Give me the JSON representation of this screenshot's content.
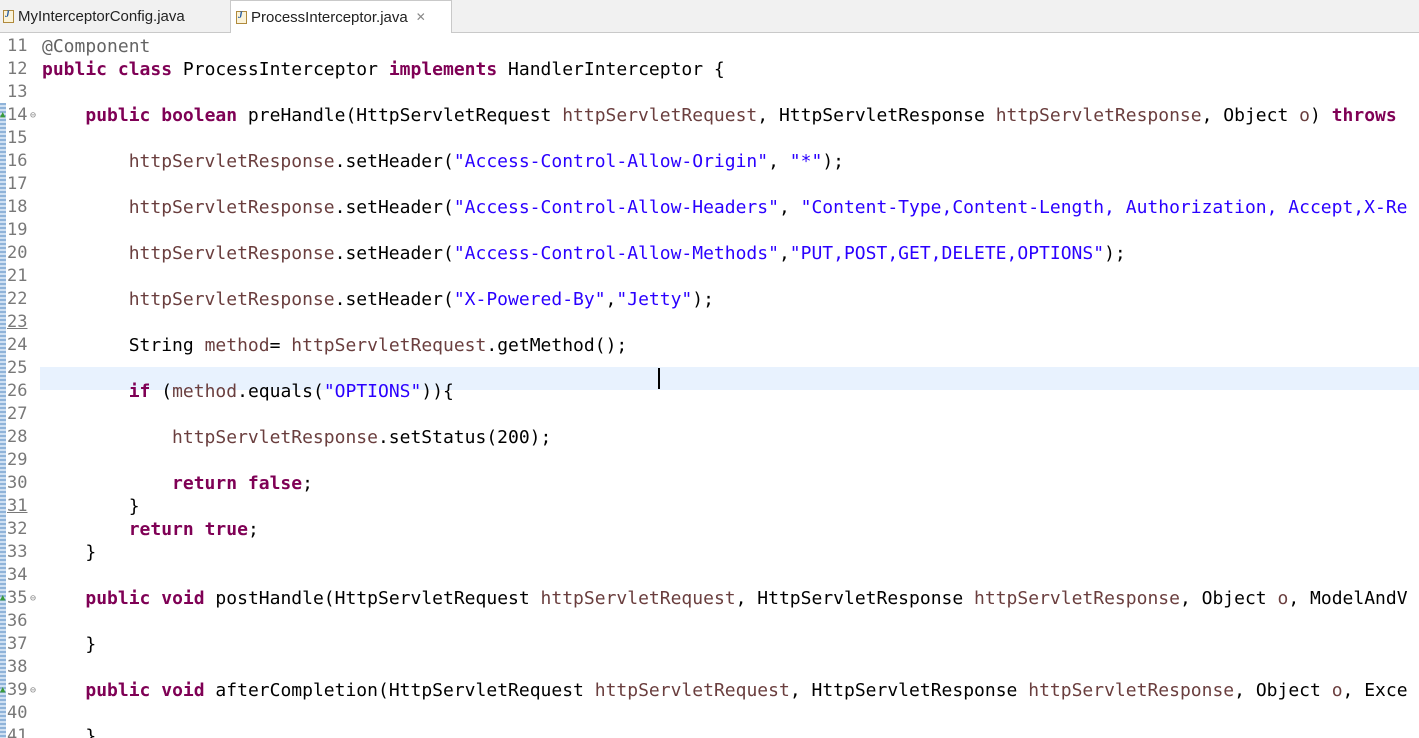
{
  "tabs": [
    {
      "label": "MyInterceptorConfig.java",
      "active": false,
      "icon": "java-file-icon"
    },
    {
      "label": "ProcessInterceptor.java",
      "active": true,
      "icon": "java-file-icon"
    }
  ],
  "tab_close_glyph": "✕",
  "editor": {
    "current_line": 24,
    "lines": [
      {
        "n": "11",
        "code": "@Component"
      },
      {
        "n": "12",
        "code": "public class ProcessInterceptor implements HandlerInterceptor {"
      },
      {
        "n": "13",
        "code": ""
      },
      {
        "n": "14",
        "code": "    public boolean preHandle(HttpServletRequest httpServletRequest, HttpServletResponse httpServletResponse, Object o) throws"
      },
      {
        "n": "15",
        "code": ""
      },
      {
        "n": "16",
        "code": "        httpServletResponse.setHeader(\"Access-Control-Allow-Origin\", \"*\");"
      },
      {
        "n": "17",
        "code": ""
      },
      {
        "n": "18",
        "code": "        httpServletResponse.setHeader(\"Access-Control-Allow-Headers\", \"Content-Type,Content-Length, Authorization, Accept,X-Re"
      },
      {
        "n": "19",
        "code": ""
      },
      {
        "n": "20",
        "code": "        httpServletResponse.setHeader(\"Access-Control-Allow-Methods\",\"PUT,POST,GET,DELETE,OPTIONS\");"
      },
      {
        "n": "21",
        "code": ""
      },
      {
        "n": "22",
        "code": "        httpServletResponse.setHeader(\"X-Powered-By\",\"Jetty\");"
      },
      {
        "n": "23",
        "code": ""
      },
      {
        "n": "24",
        "code": "        String method= httpServletRequest.getMethod();"
      },
      {
        "n": "25",
        "code": ""
      },
      {
        "n": "26",
        "code": "        if (method.equals(\"OPTIONS\")){"
      },
      {
        "n": "27",
        "code": ""
      },
      {
        "n": "28",
        "code": "            httpServletResponse.setStatus(200);"
      },
      {
        "n": "29",
        "code": ""
      },
      {
        "n": "30",
        "code": "            return false;"
      },
      {
        "n": "31",
        "code": "        }"
      },
      {
        "n": "32",
        "code": "        return true;"
      },
      {
        "n": "33",
        "code": "    }"
      },
      {
        "n": "34",
        "code": ""
      },
      {
        "n": "35",
        "code": "    public void postHandle(HttpServletRequest httpServletRequest, HttpServletResponse httpServletResponse, Object o, ModelAndV"
      },
      {
        "n": "36",
        "code": ""
      },
      {
        "n": "37",
        "code": "    }"
      },
      {
        "n": "38",
        "code": ""
      },
      {
        "n": "39",
        "code": "    public void afterCompletion(HttpServletRequest httpServletRequest, HttpServletResponse httpServletResponse, Object o, Exce"
      },
      {
        "n": "40",
        "code": ""
      },
      {
        "n": "41",
        "code": "    }"
      }
    ]
  },
  "gutter_markers": {
    "fold_lines": [
      "14",
      "35",
      "39"
    ],
    "override_lines": [
      "14",
      "35",
      "39"
    ],
    "underlined_lines": [
      "23",
      "31"
    ],
    "fold_glyph": "⊖",
    "override_glyph": "▲"
  },
  "syntax": {
    "keywords": [
      "public",
      "class",
      "implements",
      "boolean",
      "throws",
      "String",
      "if",
      "return",
      "false",
      "true",
      "void"
    ],
    "params": [
      "httpServletRequest",
      "httpServletResponse",
      "method",
      "o"
    ],
    "colors": {
      "keyword": "#7f0055",
      "string": "#2a00ff",
      "param": "#6a3e3e",
      "annotation": "#646464",
      "line_number": "#787878",
      "current_line": "#e8f2fe"
    }
  }
}
